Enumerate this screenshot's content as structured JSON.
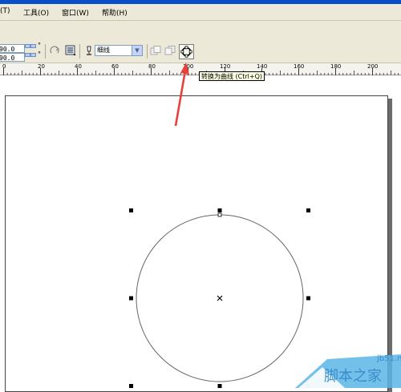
{
  "menu": {
    "items": [
      {
        "label": "(T)"
      },
      {
        "label": "工具(O)"
      },
      {
        "label": "窗口(W)"
      },
      {
        "label": "帮助(H)"
      }
    ]
  },
  "property_bar": {
    "angle_1": "90.0",
    "angle_2": "90.0",
    "degree_symbol": "°",
    "outline_width": "细线"
  },
  "ruler": {
    "ticks": [
      "0",
      "20",
      "40",
      "60",
      "80",
      "100",
      "120",
      "140",
      "160",
      "180",
      "200"
    ]
  },
  "tooltip": {
    "text": "转换为曲线 (Ctrl+Q)"
  },
  "watermark": {
    "site": "jb51.net",
    "name": "脚本之家"
  },
  "colors": {
    "toolbar_bg": "#ece9d8",
    "arrow": "#e8413c",
    "watermark": "#3a8cc9"
  }
}
